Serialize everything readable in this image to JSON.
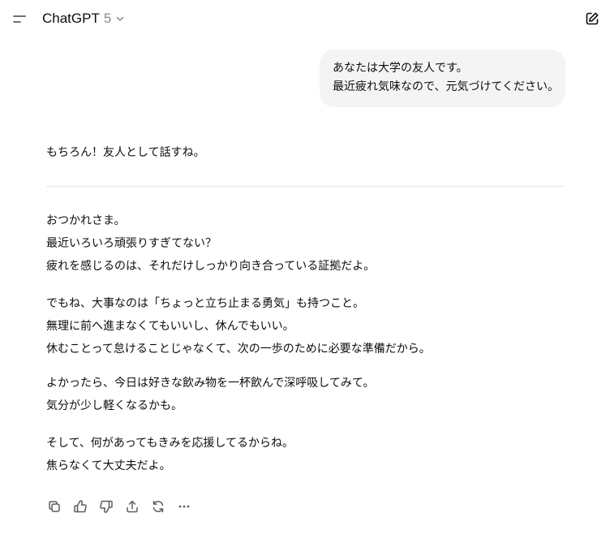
{
  "header": {
    "model_name": "ChatGPT",
    "model_version": "5"
  },
  "user_message": {
    "lines": [
      "あなたは大学の友人です。",
      "最近疲れ気味なので、元気づけてください。"
    ]
  },
  "assistant": {
    "intro": "もちろん！友人として話すね。",
    "paragraphs": [
      [
        "おつかれさま。",
        "最近いろいろ頑張りすぎてない？",
        "疲れを感じるのは、それだけしっかり向き合っている証拠だよ。"
      ],
      [
        "でもね、大事なのは「ちょっと立ち止まる勇気」も持つこと。",
        "無理に前へ進まなくてもいいし、休んでもいい。",
        "休むことって怠けることじゃなくて、次の一歩のために必要な準備だから。"
      ],
      [
        "よかったら、今日は好きな飲み物を一杯飲んで深呼吸してみて。",
        "気分が少し軽くなるかも。"
      ],
      [
        "そして、何があってもきみを応援してるからね。",
        "焦らなくて大丈夫だよ。"
      ]
    ]
  },
  "actions": [
    "copy-icon",
    "thumbs-up-icon",
    "thumbs-down-icon",
    "share-icon",
    "regenerate-icon",
    "more-icon"
  ]
}
